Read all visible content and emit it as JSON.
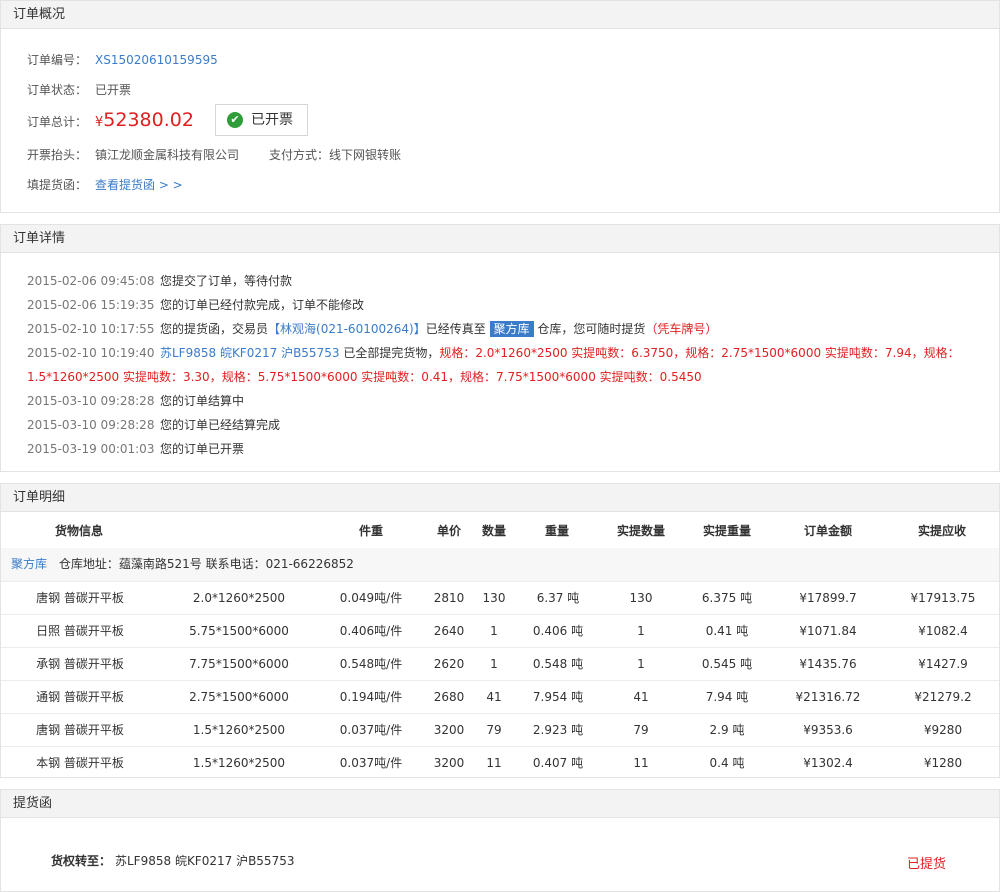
{
  "overview": {
    "title": "订单概况",
    "order_no_label": "订单编号：",
    "order_no": "XS15020610159595",
    "status_label": "订单状态：",
    "status": "已开票",
    "total_label": "订单总计：",
    "total_currency": "¥",
    "total_value": "52380.02",
    "invoice_badge": "已开票",
    "invoice_title_label": "开票抬头：",
    "invoice_title": "镇江龙顺金属科技有限公司",
    "payment_label": "支付方式：",
    "payment": "线下网银转账",
    "bol_label": "填提货函：",
    "bol_link": "查看提货函 > >"
  },
  "details": {
    "title": "订单详情",
    "logs": [
      {
        "ts": "2015-02-06 09:45:08",
        "text": "您提交了订单，等待付款"
      },
      {
        "ts": "2015-02-06 15:19:35",
        "text": "您的订单已经付款完成，订单不能修改"
      },
      {
        "ts": "2015-02-10 10:17:55",
        "pre": "您的提货函，交易员",
        "trader": "【林观海(021-60100264)】",
        "mid": "已经传真至",
        "warehouse_tag": "聚方库",
        "post": "仓库，您可随时提货",
        "note": "（凭车牌号）"
      },
      {
        "ts": "2015-02-10 10:19:40",
        "plates": "苏LF9858 皖KF0217 沪B55753",
        "mid": "已全部提完货物，",
        "spec1": "规格：2.0*1260*2500 实提吨数：6.3750，规格：2.75*1500*6000 实提吨数：7.94，规格：",
        "spec2": "1.5*1260*2500 实提吨数：3.30，规格：5.75*1500*6000 实提吨数：0.41，规格：7.75*1500*6000 实提吨数：0.5450"
      },
      {
        "ts": "2015-03-10 09:28:28",
        "text": "您的订单结算中"
      },
      {
        "ts": "2015-03-10 09:28:28",
        "text": "您的订单已经结算完成"
      },
      {
        "ts": "2015-03-19 00:01:03",
        "text": "您的订单已开票"
      }
    ]
  },
  "items": {
    "title": "订单明细",
    "headers": [
      "货物信息",
      "件重",
      "单价",
      "数量",
      "重量",
      "实提数量",
      "实提重量",
      "订单金额",
      "实提应收"
    ],
    "warehouse_name": "聚方库",
    "warehouse_info": "仓库地址：蕴藻南路521号 联系电话：021-66226852",
    "rows": [
      {
        "brand": "唐钢 普碳开平板",
        "spec": "2.0*1260*2500",
        "unit_weight": "0.049吨/件",
        "price": "2810",
        "qty": "130",
        "weight": "6.37 吨",
        "actual_qty": "130",
        "actual_weight": "6.375 吨",
        "amount": "¥17899.7",
        "receivable": "¥17913.75"
      },
      {
        "brand": "日照 普碳开平板",
        "spec": "5.75*1500*6000",
        "unit_weight": "0.406吨/件",
        "price": "2640",
        "qty": "1",
        "weight": "0.406 吨",
        "actual_qty": "1",
        "actual_weight": "0.41 吨",
        "amount": "¥1071.84",
        "receivable": "¥1082.4"
      },
      {
        "brand": "承钢 普碳开平板",
        "spec": "7.75*1500*6000",
        "unit_weight": "0.548吨/件",
        "price": "2620",
        "qty": "1",
        "weight": "0.548 吨",
        "actual_qty": "1",
        "actual_weight": "0.545 吨",
        "amount": "¥1435.76",
        "receivable": "¥1427.9"
      },
      {
        "brand": "通钢 普碳开平板",
        "spec": "2.75*1500*6000",
        "unit_weight": "0.194吨/件",
        "price": "2680",
        "qty": "41",
        "weight": "7.954 吨",
        "actual_qty": "41",
        "actual_weight": "7.94 吨",
        "amount": "¥21316.72",
        "receivable": "¥21279.2"
      },
      {
        "brand": "唐钢 普碳开平板",
        "spec": "1.5*1260*2500",
        "unit_weight": "0.037吨/件",
        "price": "3200",
        "qty": "79",
        "weight": "2.923 吨",
        "actual_qty": "79",
        "actual_weight": "2.9 吨",
        "amount": "¥9353.6",
        "receivable": "¥9280"
      },
      {
        "brand": "本钢 普碳开平板",
        "spec": "1.5*1260*2500",
        "unit_weight": "0.037吨/件",
        "price": "3200",
        "qty": "11",
        "weight": "0.407 吨",
        "actual_qty": "11",
        "actual_weight": "0.4 吨",
        "amount": "¥1302.4",
        "receivable": "¥1280"
      }
    ]
  },
  "bill_of_lading": {
    "title": "提货函",
    "transfer_label": "货权转至：",
    "transfer_value": "苏LF9858 皖KF0217 沪B55753",
    "status": "已提货"
  }
}
